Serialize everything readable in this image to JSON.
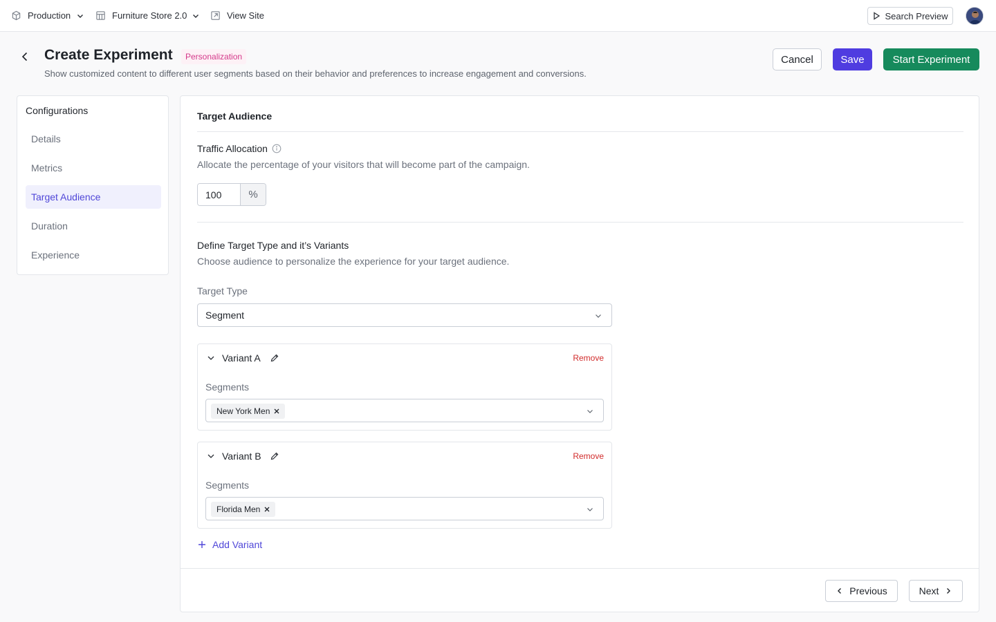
{
  "topbar": {
    "environment": "Production",
    "project": "Furniture Store 2.0",
    "view_site": "View Site",
    "search_preview": "Search Preview"
  },
  "header": {
    "title": "Create Experiment",
    "badge": "Personalization",
    "description": "Show customized content to different user segments based on their behavior and preferences to increase engagement and conversions.",
    "cancel": "Cancel",
    "save": "Save",
    "start": "Start Experiment"
  },
  "sidebar": {
    "title": "Configurations",
    "items": [
      {
        "label": "Details"
      },
      {
        "label": "Metrics"
      },
      {
        "label": "Target Audience",
        "active": true
      },
      {
        "label": "Duration"
      },
      {
        "label": "Experience"
      }
    ]
  },
  "main": {
    "section_title": "Target Audience",
    "traffic": {
      "label": "Traffic Allocation",
      "description": "Allocate the percentage of your visitors that will become part of the campaign.",
      "value": "100",
      "suffix": "%"
    },
    "target": {
      "heading": "Define Target Type and it’s Variants",
      "description": "Choose audience to personalize the experience for your target audience.",
      "type_label": "Target Type",
      "type_value": "Segment"
    },
    "variants": [
      {
        "name": "Variant A",
        "remove": "Remove",
        "segments_label": "Segments",
        "segment_tag": "New York Men"
      },
      {
        "name": "Variant B",
        "remove": "Remove",
        "segments_label": "Segments",
        "segment_tag": "Florida Men"
      }
    ],
    "add_variant": "Add Variant",
    "previous": "Previous",
    "next": "Next"
  },
  "colors": {
    "accent": "#4f3ce0",
    "start_button": "#168a5c",
    "badge_text": "#d4388a",
    "remove_text": "#d12b2b",
    "active_nav_bg": "#f0f0fd"
  }
}
